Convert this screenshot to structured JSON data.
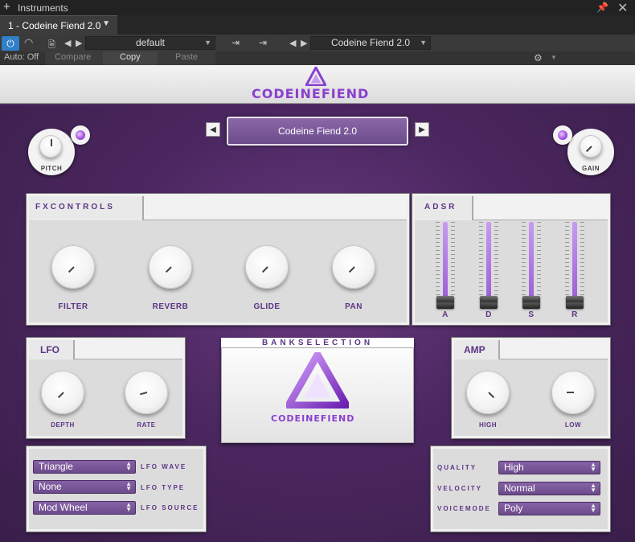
{
  "window": {
    "title": "Instruments"
  },
  "tab": {
    "label": "1 - Codeine Fiend 2.0"
  },
  "toolbar": {
    "preset_name": "default",
    "instrument_name": "Codeine Fiend 2.0",
    "auto_label": "Auto: Off",
    "compare_label": "Compare",
    "copy_label": "Copy",
    "paste_label": "Paste"
  },
  "header": {
    "logo_text": "CODEINEFIEND"
  },
  "preset": {
    "name": "Codeine Fiend 2.0"
  },
  "pitch": {
    "label": "PITCH"
  },
  "gain": {
    "label": "GAIN"
  },
  "fx": {
    "title": "FXCONTROLS",
    "knobs": [
      {
        "label": "FILTER"
      },
      {
        "label": "REVERB"
      },
      {
        "label": "GLIDE"
      },
      {
        "label": "PAN"
      }
    ]
  },
  "adsr": {
    "title": "ADSR",
    "sliders": [
      {
        "label": "A",
        "level": 0.0
      },
      {
        "label": "D",
        "level": 0.0
      },
      {
        "label": "S",
        "level": 0.0
      },
      {
        "label": "R",
        "level": 0.0
      }
    ]
  },
  "lfo": {
    "title": "LFO",
    "knobs": [
      {
        "label": "DEPTH"
      },
      {
        "label": "RATE"
      }
    ],
    "wave": {
      "label": "LFO WAVE",
      "value": "Triangle"
    },
    "type": {
      "label": "LFO TYPE",
      "value": "None"
    },
    "source": {
      "label": "LFO SOURCE",
      "value": "Mod Wheel"
    }
  },
  "bank": {
    "title": "BANKSELECTION",
    "logo_text": "CODEINEFIEND"
  },
  "amp": {
    "title": "AMP",
    "knobs": [
      {
        "label": "HIGH"
      },
      {
        "label": "LOW"
      }
    ]
  },
  "settings": {
    "quality": {
      "label": "QUALITY",
      "value": "High"
    },
    "velocity": {
      "label": "VELOCITY",
      "value": "Normal"
    },
    "voicemode": {
      "label": "VOICEMODE",
      "value": "Poly"
    }
  },
  "colors": {
    "accent": "#8a3fd0",
    "panel": "#dcdcdc",
    "host_blue": "#2f80c8"
  }
}
